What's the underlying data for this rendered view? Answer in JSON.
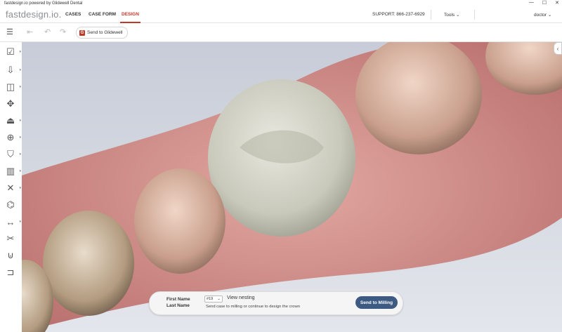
{
  "window": {
    "title": "fastdesign.io powered by Glidewell Dental",
    "minimize": "—",
    "maximize": "☐",
    "close": "✕"
  },
  "nav": {
    "logo": "fastdesign.io.",
    "tabs": [
      {
        "label": "CASES"
      },
      {
        "label": "CASE FORM"
      },
      {
        "label": "DESIGN",
        "active": true
      }
    ],
    "support": "SUPPORT: 866-237-6929",
    "tools": "Tools",
    "user": "doctor"
  },
  "toolbar": {
    "menu_icon": "menu-icon",
    "first_icon": "skip-first-icon",
    "undo_icon": "undo-icon",
    "redo_icon": "redo-icon",
    "send_glidewell_label": "Send to Glidewell",
    "glidewell_logo": "G"
  },
  "sidebar": {
    "items": [
      {
        "icon": "checklist-icon"
      },
      {
        "icon": "import-icon"
      },
      {
        "icon": "crown-shape-icon"
      },
      {
        "icon": "move-icon"
      },
      {
        "icon": "contact-icon"
      },
      {
        "icon": "add-tooth-icon"
      },
      {
        "icon": "tooth-icon"
      },
      {
        "icon": "ruler-icon"
      },
      {
        "icon": "tools-icon"
      },
      {
        "icon": "full-arch-icon"
      },
      {
        "icon": "measure-icon"
      },
      {
        "icon": "cut-icon"
      },
      {
        "icon": "margin-icon"
      },
      {
        "icon": "bite-icon"
      }
    ]
  },
  "bottom_bar": {
    "first_name_label": "First Name",
    "last_name_label": "Last Name",
    "tooth_number": "#19",
    "view_nesting": "View nesting",
    "description": "Send case to milling or continue to design the crown",
    "send_to_milling": "Send to Milling"
  },
  "colors": {
    "accent": "#c0392b",
    "primary_button": "#3c5a82"
  }
}
